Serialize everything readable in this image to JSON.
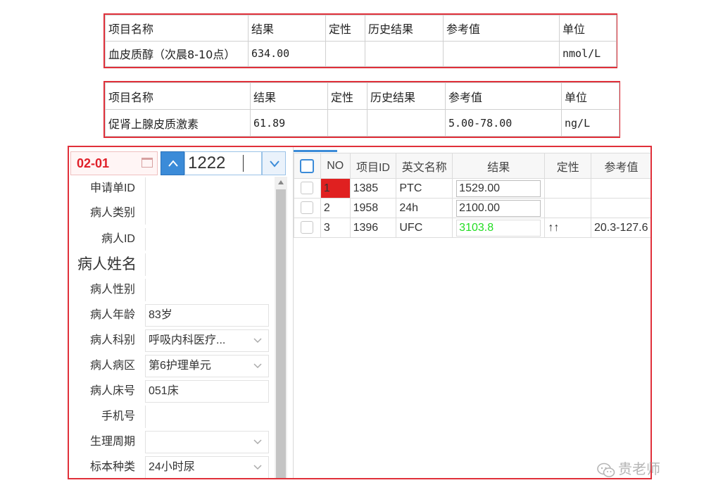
{
  "table1": {
    "headers": [
      "项目名称",
      "结果",
      "定性",
      "历史结果",
      "参考值",
      "单位"
    ],
    "row": [
      "血皮质醇（次晨8-10点）",
      "634.00",
      "",
      "",
      "",
      "nmol/L"
    ]
  },
  "table2": {
    "headers": [
      "项目名称",
      "结果",
      "定性",
      "历史结果",
      "参考值",
      "单位"
    ],
    "row": [
      "促肾上腺皮质激素",
      "61.89",
      "",
      "",
      "5.00-78.00",
      "ng/L"
    ]
  },
  "lis": {
    "date": "02-01",
    "sample_no": "1222",
    "form": {
      "request_id": {
        "label": "申请单ID",
        "value": ""
      },
      "patient_type": {
        "label": "病人类别",
        "value": ""
      },
      "patient_id": {
        "label": "病人ID",
        "value": ""
      },
      "patient_name": {
        "label": "病人姓名",
        "value": ""
      },
      "patient_sex": {
        "label": "病人性别",
        "value": ""
      },
      "patient_age": {
        "label": "病人年龄",
        "value": "83岁"
      },
      "department": {
        "label": "病人科别",
        "value": "呼吸内科医疗..."
      },
      "ward": {
        "label": "病人病区",
        "value": "第6护理单元"
      },
      "bed": {
        "label": "病人床号",
        "value": "051床"
      },
      "phone": {
        "label": "手机号",
        "value": ""
      },
      "cycle": {
        "label": "生理周期",
        "value": ""
      },
      "specimen": {
        "label": "标本种类",
        "value": "24小时尿"
      }
    },
    "grid": {
      "headers": {
        "no": "NO",
        "item_id": "项目ID",
        "eng_name": "英文名称",
        "result": "结果",
        "flag": "定性",
        "ref": "参考值"
      },
      "rows": [
        {
          "no": "1",
          "item_id": "1385",
          "eng_name": "PTC",
          "result": "1529.00",
          "flag": "",
          "ref": ""
        },
        {
          "no": "2",
          "item_id": "1958",
          "eng_name": "24h",
          "result": "2100.00",
          "flag": "",
          "ref": ""
        },
        {
          "no": "3",
          "item_id": "1396",
          "eng_name": "UFC",
          "result": "3103.8",
          "flag": "↑↑",
          "ref": "20.3-127.6"
        }
      ]
    }
  },
  "watermark": "贵老师",
  "colors": {
    "border_red": "#e0303a",
    "accent_blue": "#3b8bd8",
    "high_green": "#22dd22"
  }
}
